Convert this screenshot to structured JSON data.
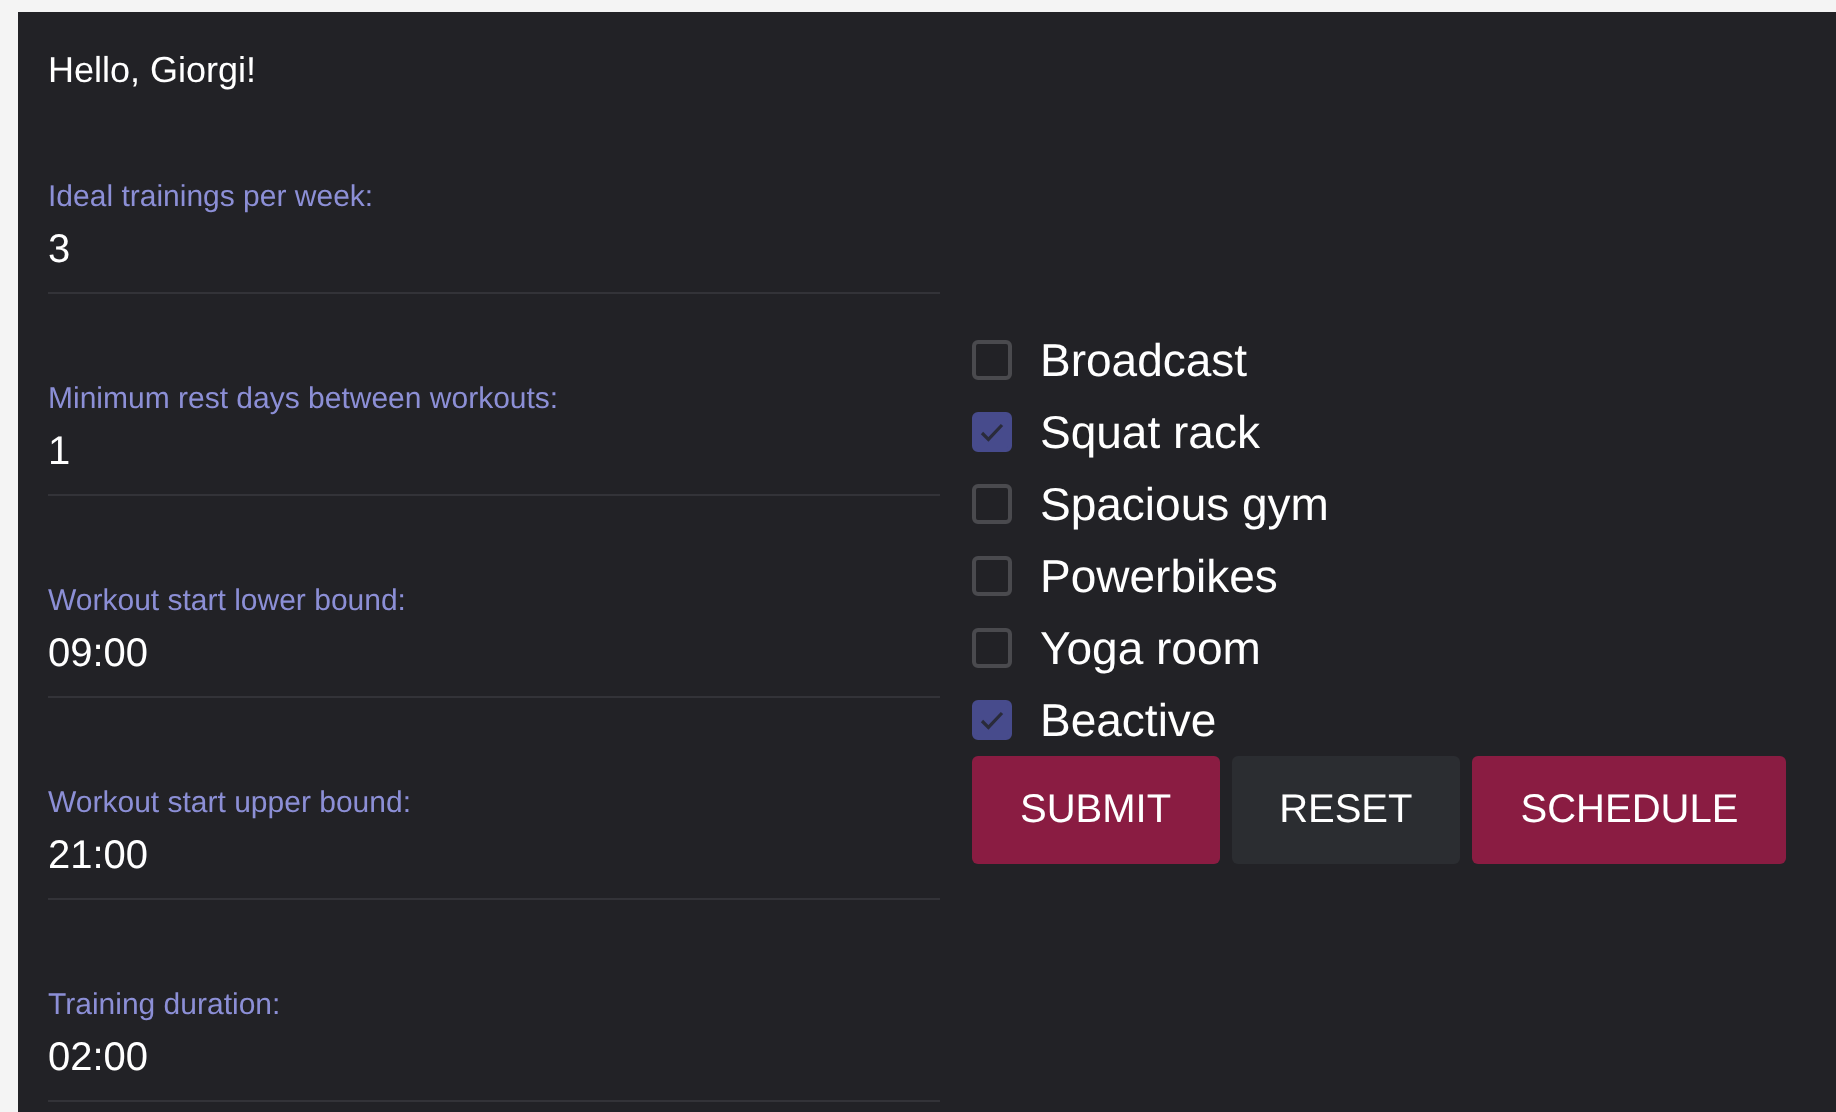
{
  "greeting": "Hello, Giorgi!",
  "fields": [
    {
      "label": "Ideal trainings per week:",
      "value": "3"
    },
    {
      "label": "Minimum rest days between workouts:",
      "value": "1"
    },
    {
      "label": "Workout start lower bound:",
      "value": "09:00"
    },
    {
      "label": "Workout start upper bound:",
      "value": "21:00"
    },
    {
      "label": "Training duration:",
      "value": "02:00"
    }
  ],
  "amenities": [
    {
      "label": "Broadcast",
      "checked": false
    },
    {
      "label": "Squat rack",
      "checked": true
    },
    {
      "label": "Spacious gym",
      "checked": false
    },
    {
      "label": "Powerbikes",
      "checked": false
    },
    {
      "label": "Yoga room",
      "checked": false
    },
    {
      "label": "Beactive",
      "checked": true
    }
  ],
  "buttons": [
    {
      "label": "SUBMIT",
      "kind": "primary"
    },
    {
      "label": "RESET",
      "kind": "secondary"
    },
    {
      "label": "SCHEDULE",
      "kind": "primary"
    }
  ]
}
